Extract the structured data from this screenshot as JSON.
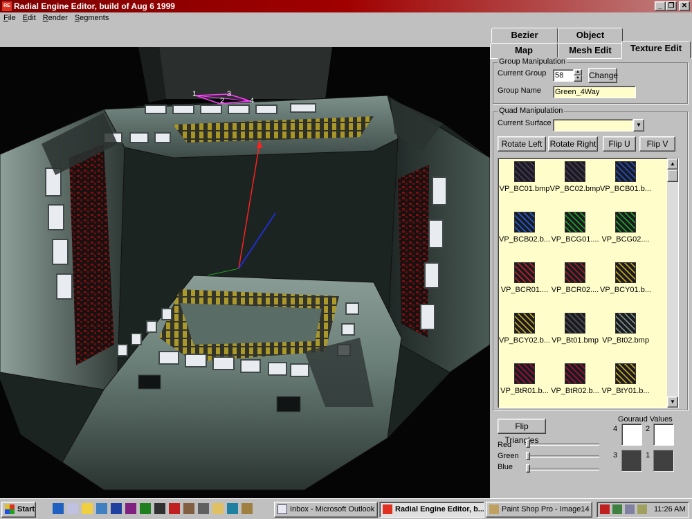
{
  "window": {
    "title": "Radial Engine Editor, build of Aug  6 1999",
    "icon_label": "RE",
    "controls": [
      "_",
      "❐",
      "✕"
    ]
  },
  "menu": [
    "File",
    "Edit",
    "Render",
    "Segments"
  ],
  "viewport": {
    "vertex_labels": [
      "1",
      "3",
      "2",
      "4"
    ],
    "colors": {
      "background": "#050505",
      "panel": "#3a4a42",
      "light": "#e8ecf0",
      "hazard": "#b09a20",
      "red_light": "#8a1010",
      "axis_red": "#ff2020",
      "axis_blue": "#2030ff",
      "selection": "#ff40ff"
    }
  },
  "tabs": {
    "row1": [
      "Bezier",
      "Object"
    ],
    "row2": [
      "Map",
      "Mesh Edit",
      "Texture Edit"
    ],
    "active": "Texture Edit"
  },
  "group_manipulation": {
    "title": "Group Manipulation",
    "current_group_label": "Current Group",
    "current_group_value": "58",
    "change_button": "Change",
    "group_name_label": "Group Name",
    "group_name_value": "Green_4Way"
  },
  "quad_manipulation": {
    "title": "Quad Manipulation",
    "current_surface_label": "Current Surface",
    "current_surface_value": "",
    "buttons": [
      "Rotate Left",
      "Rotate Right",
      "Flip U",
      "Flip V"
    ]
  },
  "textures": [
    {
      "name": "VP_BC01.bmp",
      "color": "#4a3a55",
      "icon": "panel-dark"
    },
    {
      "name": "VP_BC02.bmp",
      "color": "#4a3a50",
      "icon": "panel-dark"
    },
    {
      "name": "VP_BCB01.b...",
      "color": "#2050c0",
      "icon": "circuit-blue"
    },
    {
      "name": "VP_BCB02.b...",
      "color": "#2060d0",
      "icon": "circuit-blue"
    },
    {
      "name": "VP_BCG01....",
      "color": "#20a020",
      "icon": "circuit-green"
    },
    {
      "name": "VP_BCG02....",
      "color": "#20a020",
      "icon": "circuit-green"
    },
    {
      "name": "VP_BCR01....",
      "color": "#c02020",
      "icon": "circuit-red"
    },
    {
      "name": "VP_BCR02....",
      "color": "#a02020",
      "icon": "circuit-red"
    },
    {
      "name": "VP_BCY01.b...",
      "color": "#c0a020",
      "icon": "circuit-yellow"
    },
    {
      "name": "VP_BCY02.b...",
      "color": "#c0a020",
      "icon": "circuit-yellow"
    },
    {
      "name": "VP_Bt01.bmp",
      "color": "#505050",
      "icon": "crate-grey"
    },
    {
      "name": "VP_Bt02.bmp",
      "color": "#7a9080",
      "icon": "crate-green"
    },
    {
      "name": "VP_BtR01.b...",
      "color": "#a01030",
      "icon": "light-red"
    },
    {
      "name": "VP_BtR02.b...",
      "color": "#a01030",
      "icon": "light-red"
    },
    {
      "name": "VP_BtY01.b...",
      "color": "#c0a020",
      "icon": "light-yellow"
    }
  ],
  "flip_triangles_button": "Flip Triangles",
  "gouraud": {
    "title": "Gouraud Values",
    "corners": [
      {
        "label": "4",
        "color": "#ffffff"
      },
      {
        "label": "2",
        "color": "#ffffff"
      },
      {
        "label": "3",
        "color": "#404040"
      },
      {
        "label": "1",
        "color": "#404040"
      }
    ]
  },
  "sliders": [
    {
      "label": "Red",
      "value": 0
    },
    {
      "label": "Green",
      "value": 0
    },
    {
      "label": "Blue",
      "value": 0
    }
  ],
  "taskbar": {
    "start_label": "Start",
    "quick_icons": [
      "ie-icon",
      "outlook-icon",
      "find-icon",
      "desktop-icon",
      "word-icon",
      "paint-icon",
      "game-icon",
      "terminal-icon",
      "acrobat-icon",
      "sound-icon",
      "video-icon",
      "folder-icon",
      "monitor-icon",
      "tool-icon"
    ],
    "tasks": [
      {
        "label": "Inbox - Microsoft Outlook",
        "active": false
      },
      {
        "label": "Radial Engine Editor, b...",
        "active": true
      },
      {
        "label": "Paint Shop Pro - Image14",
        "active": false
      }
    ],
    "clock": "11:26 AM"
  }
}
